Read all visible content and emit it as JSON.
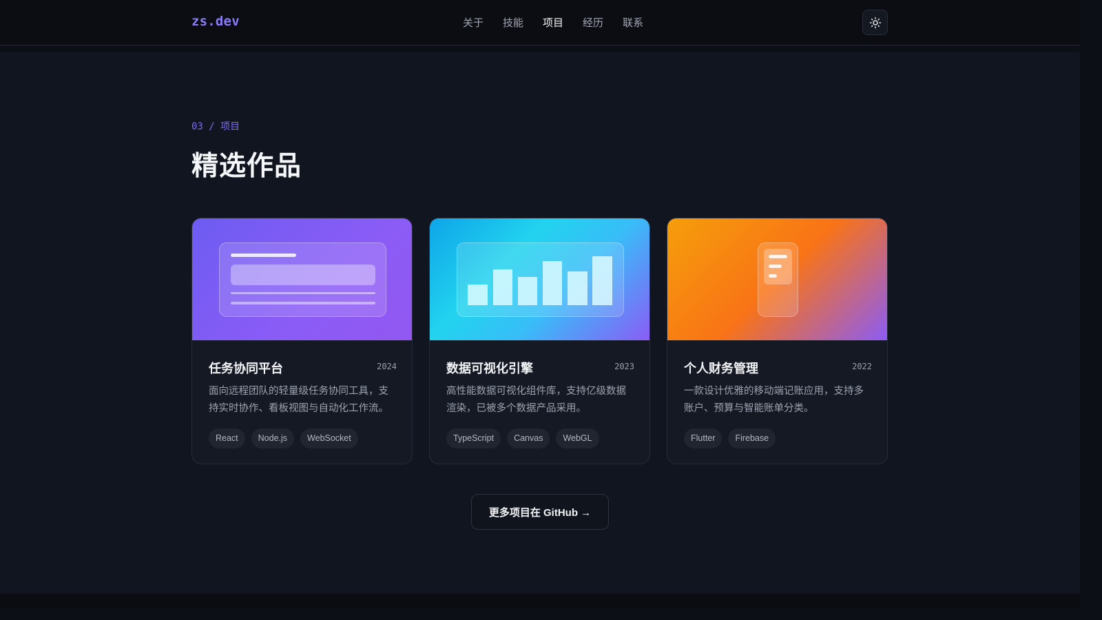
{
  "header": {
    "logo": "zs.dev",
    "nav": [
      {
        "label": "关于",
        "active": false
      },
      {
        "label": "技能",
        "active": false
      },
      {
        "label": "项目",
        "active": true
      },
      {
        "label": "经历",
        "active": false
      },
      {
        "label": "联系",
        "active": false
      }
    ],
    "theme_toggle_icon": "sun-icon"
  },
  "section": {
    "eyebrow": "03 / 项目",
    "title": "精选作品"
  },
  "projects": [
    {
      "title": "任务协同平台",
      "year": "2024",
      "description": "面向远程团队的轻量级任务协同工具，支持实时协作、看板视图与自动化工作流。",
      "tags": [
        "React",
        "Node.js",
        "WebSocket"
      ],
      "illustration": "dashboard-illustration",
      "gradient": [
        "#6d5cf2",
        "#8b5cf6"
      ]
    },
    {
      "title": "数据可视化引擎",
      "year": "2023",
      "description": "高性能数据可视化组件库，支持亿级数据渲染，已被多个数据产品采用。",
      "tags": [
        "TypeScript",
        "Canvas",
        "WebGL"
      ],
      "illustration": "bar-chart-illustration",
      "gradient": [
        "#0ea5e9",
        "#22d3ee",
        "#8b5cf6"
      ]
    },
    {
      "title": "个人财务管理",
      "year": "2022",
      "description": "一款设计优雅的移动端记账应用，支持多账户、预算与智能账单分类。",
      "tags": [
        "Flutter",
        "Firebase"
      ],
      "illustration": "phone-illustration",
      "gradient": [
        "#f59e0b",
        "#f97316",
        "#8b5cf6"
      ]
    }
  ],
  "more_button": "更多项目在 GitHub →",
  "colors": {
    "accent": "#8b7cf6",
    "background": "#111520",
    "card": "#151924"
  }
}
